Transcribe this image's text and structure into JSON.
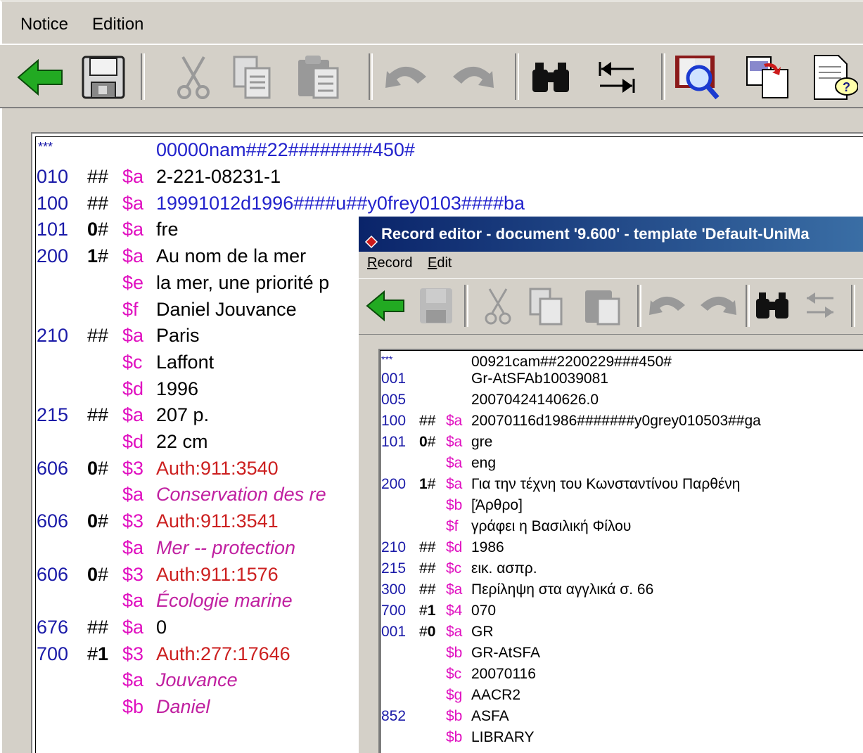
{
  "main": {
    "menu": [
      "Notice",
      "Edition"
    ],
    "leader": {
      "tag": "***",
      "value": "00000nam##22########450#"
    },
    "records": [
      {
        "tag": "010",
        "ind": "##",
        "sub": "$a",
        "val": "2-221-08231-1",
        "style": ""
      },
      {
        "tag": "100",
        "ind": "##",
        "sub": "$a",
        "val": "19991012d1996####u##y0frey0103####ba",
        "style": "blue"
      },
      {
        "tag": "101",
        "ind": "0#",
        "sub": "$a",
        "val": "fre",
        "style": ""
      },
      {
        "tag": "200",
        "ind": "1#",
        "sub": "$a",
        "val": "Au nom de la mer",
        "style": ""
      },
      {
        "tag": "",
        "ind": "",
        "sub": "$e",
        "val": "la mer, une priorité p",
        "style": ""
      },
      {
        "tag": "",
        "ind": "",
        "sub": "$f",
        "val": "Daniel Jouvance",
        "style": ""
      },
      {
        "tag": "210",
        "ind": "##",
        "sub": "$a",
        "val": "Paris",
        "style": ""
      },
      {
        "tag": "",
        "ind": "",
        "sub": "$c",
        "val": "Laffont",
        "style": ""
      },
      {
        "tag": "",
        "ind": "",
        "sub": "$d",
        "val": "1996",
        "style": ""
      },
      {
        "tag": "215",
        "ind": "##",
        "sub": "$a",
        "val": "207 p.",
        "style": ""
      },
      {
        "tag": "",
        "ind": "",
        "sub": "$d",
        "val": "22 cm",
        "style": ""
      },
      {
        "tag": "606",
        "ind": "0#",
        "sub": "$3",
        "val": "Auth:911:3540",
        "style": "red"
      },
      {
        "tag": "",
        "ind": "",
        "sub": "$a",
        "val": "Conservation des re",
        "style": "italic"
      },
      {
        "tag": "606",
        "ind": "0#",
        "sub": "$3",
        "val": "Auth:911:3541",
        "style": "red"
      },
      {
        "tag": "",
        "ind": "",
        "sub": "$a",
        "val": "Mer -- protection",
        "style": "italic"
      },
      {
        "tag": "606",
        "ind": "0#",
        "sub": "$3",
        "val": "Auth:911:1576",
        "style": "red"
      },
      {
        "tag": "",
        "ind": "",
        "sub": "$a",
        "val": "Écologie marine",
        "style": "italic"
      },
      {
        "tag": "676",
        "ind": "##",
        "sub": "$a",
        "val": "0",
        "style": ""
      },
      {
        "tag": "700",
        "ind": "#1",
        "sub": "$3",
        "val": "Auth:277:17646",
        "style": "red"
      },
      {
        "tag": "",
        "ind": "",
        "sub": "$a",
        "val": "Jouvance",
        "style": "italic"
      },
      {
        "tag": "",
        "ind": "",
        "sub": "$b",
        "val": "Daniel",
        "style": "italic"
      }
    ]
  },
  "secondary": {
    "title": "Record editor - document '9.600' - template 'Default-UniMa",
    "menu": [
      "Record",
      "Edit"
    ],
    "leader": {
      "tag": "***",
      "value": "00921cam##2200229###450#"
    },
    "records": [
      {
        "tag": "001",
        "ind": "",
        "sub": "",
        "val": "Gr-AtSFAb10039081",
        "style": ""
      },
      {
        "tag": "005",
        "ind": "",
        "sub": "",
        "val": "20070424140626.0",
        "style": ""
      },
      {
        "tag": "100",
        "ind": "##",
        "sub": "$a",
        "val": "20070116d1986#######y0grey010503##ga",
        "style": "blue"
      },
      {
        "tag": "101",
        "ind": "0#",
        "sub": "$a",
        "val": "gre",
        "style": ""
      },
      {
        "tag": "",
        "ind": "",
        "sub": "$a",
        "val": "eng",
        "style": ""
      },
      {
        "tag": "200",
        "ind": "1#",
        "sub": "$a",
        "val": "Για την τέχνη του Κωνσταντίνου Παρθένη",
        "style": ""
      },
      {
        "tag": "",
        "ind": "",
        "sub": "$b",
        "val": "[Άρθρο]",
        "style": ""
      },
      {
        "tag": "",
        "ind": "",
        "sub": "$f",
        "val": "γράφει η Βασιλική Φίλου",
        "style": ""
      },
      {
        "tag": "210",
        "ind": "##",
        "sub": "$d",
        "val": "1986",
        "style": ""
      },
      {
        "tag": "215",
        "ind": "##",
        "sub": "$c",
        "val": "εικ. ασπρ.",
        "style": ""
      },
      {
        "tag": "300",
        "ind": "##",
        "sub": "$a",
        "val": "Περίληψη στα αγγλικά σ. 66",
        "style": ""
      },
      {
        "tag": "700",
        "ind": "#1",
        "sub": "$4",
        "val": "070",
        "style": ""
      },
      {
        "tag": "001",
        "ind": "#0",
        "sub": "$a",
        "val": "GR",
        "style": ""
      },
      {
        "tag": "",
        "ind": "",
        "sub": "$b",
        "val": "GR-AtSFA",
        "style": ""
      },
      {
        "tag": "",
        "ind": "",
        "sub": "$c",
        "val": "20070116",
        "style": ""
      },
      {
        "tag": "",
        "ind": "",
        "sub": "$g",
        "val": "AACR2",
        "style": ""
      },
      {
        "tag": "852",
        "ind": "",
        "sub": "$b",
        "val": "ASFA",
        "style": ""
      },
      {
        "tag": "",
        "ind": "",
        "sub": "$b",
        "val": "LIBRARY",
        "style": ""
      }
    ]
  },
  "colors": {
    "tag": "#1a1aa8",
    "subfield": "#e010c0",
    "auth": "#cc2020",
    "title_bar": "#0a246a"
  },
  "icons": {
    "main_toolbar": [
      "back-arrow-icon",
      "save-disk-icon",
      "cut-scissors-icon",
      "copy-icon",
      "paste-icon",
      "undo-icon",
      "redo-icon",
      "binoculars-find-icon",
      "swap-arrows-icon",
      "book-magnifier-icon",
      "copy-document-icon",
      "document-help-icon"
    ],
    "secondary_toolbar": [
      "back-arrow-icon",
      "save-disk-icon",
      "cut-scissors-icon",
      "copy-icon",
      "paste-icon",
      "undo-icon",
      "redo-icon",
      "binoculars-find-icon",
      "swap-arrows-icon"
    ]
  }
}
